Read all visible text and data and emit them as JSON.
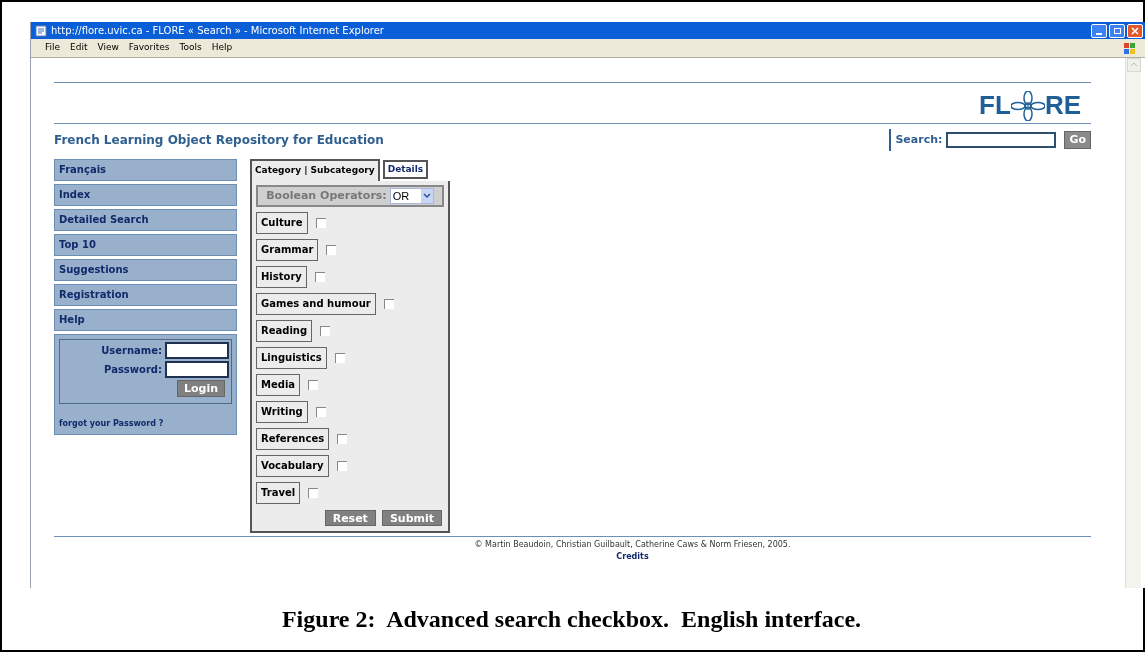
{
  "window": {
    "title": "http://flore.uvic.ca - FLORE « Search » - Microsoft Internet Explorer"
  },
  "menu": [
    "File",
    "Edit",
    "View",
    "Favorites",
    "Tools",
    "Help"
  ],
  "header": {
    "logo_left": "FL",
    "logo_right": "RE",
    "tagline": "French Learning Object Repository for Education",
    "search_label": "Search:",
    "go_button": "Go"
  },
  "nav": [
    "Français",
    "Index",
    "Detailed Search",
    "Top 10",
    "Suggestions",
    "Registration",
    "Help"
  ],
  "login": {
    "username_label": "Username:",
    "password_label": "Password:",
    "button": "Login",
    "forgot_link": "forgot your Password ?"
  },
  "tabs": [
    {
      "label": "Category | Subcategory",
      "selected": true
    },
    {
      "label": "Details",
      "selected": false
    }
  ],
  "boolean": {
    "label": "Boolean Operators:",
    "value": "OR"
  },
  "categories": [
    {
      "label": "Culture",
      "checked": false
    },
    {
      "label": "Grammar",
      "checked": false
    },
    {
      "label": "History",
      "checked": false
    },
    {
      "label": "Games and humour",
      "checked": false
    },
    {
      "label": "Reading",
      "checked": false
    },
    {
      "label": "Linguistics",
      "checked": false
    },
    {
      "label": "Media",
      "checked": false
    },
    {
      "label": "Writing",
      "checked": false
    },
    {
      "label": "References",
      "checked": false
    },
    {
      "label": "Vocabulary",
      "checked": false
    },
    {
      "label": "Travel",
      "checked": false
    }
  ],
  "buttons": [
    "Reset",
    "Submit"
  ],
  "footer": {
    "copyright": "© Martin Beaudoin, Christian Guilbault, Catherine Caws & Norm Friesen, 2005.",
    "credits": "Credits"
  },
  "caption": "Figure 2:  Advanced search checkbox.  English interface."
}
